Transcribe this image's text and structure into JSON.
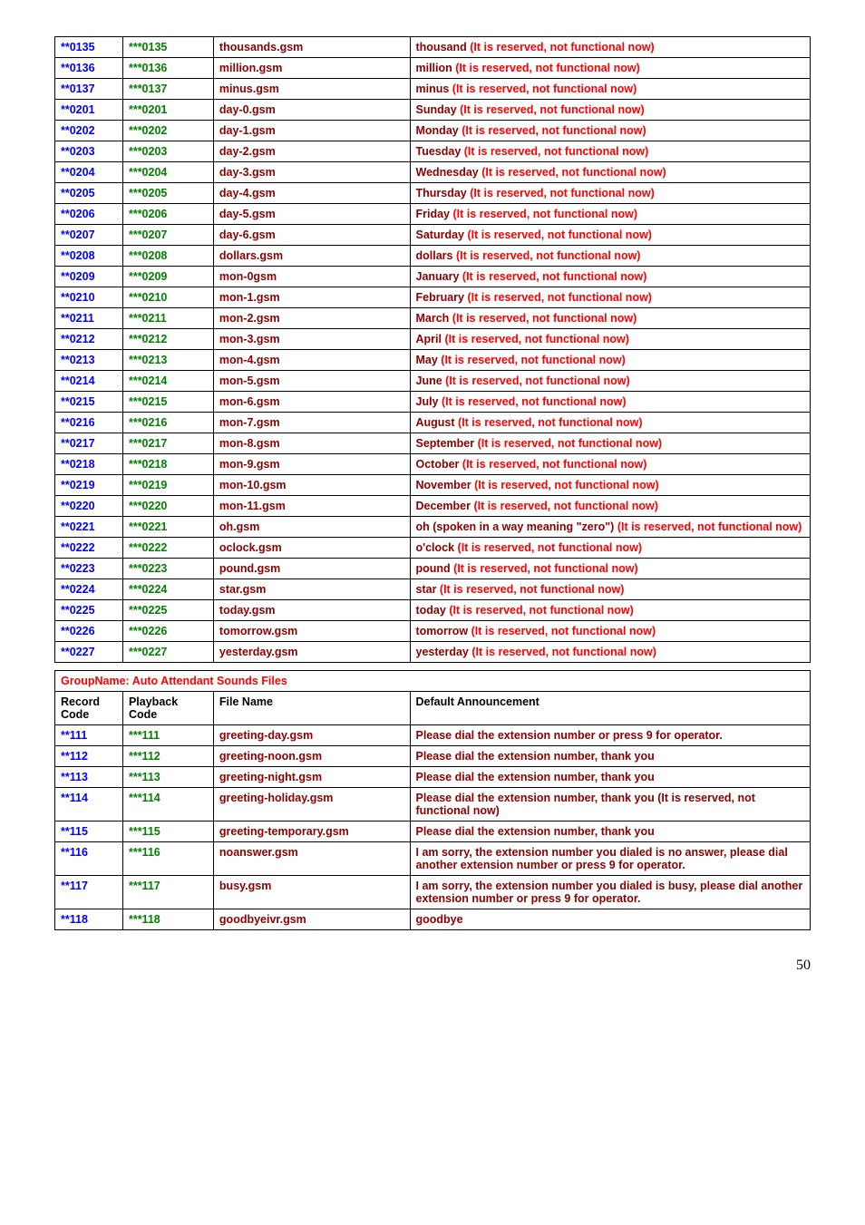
{
  "table1": [
    {
      "c1": "**0135",
      "c2": "***0135",
      "file": "thousands.gsm",
      "pre": "thousand ",
      "post": "(It is reserved, not functional now)"
    },
    {
      "c1": "**0136",
      "c2": "***0136",
      "file": "million.gsm",
      "pre": "million ",
      "post": "(It is reserved, not functional now)"
    },
    {
      "c1": "**0137",
      "c2": "***0137",
      "file": "minus.gsm",
      "pre": "minus ",
      "post": "(It is reserved, not functional now)"
    },
    {
      "c1": "**0201",
      "c2": "***0201",
      "file": "day-0.gsm",
      "pre": "Sunday ",
      "post": "(It is reserved, not functional now)"
    },
    {
      "c1": "**0202",
      "c2": "***0202",
      "file": "day-1.gsm",
      "pre": "Monday ",
      "post": "(It is reserved, not functional now)"
    },
    {
      "c1": "**0203",
      "c2": "***0203",
      "file": "day-2.gsm",
      "pre": "Tuesday ",
      "post": "(It is reserved, not functional now)"
    },
    {
      "c1": "**0204",
      "c2": "***0204",
      "file": "day-3.gsm",
      "pre": "Wednesday ",
      "post": "(It is reserved, not functional now)"
    },
    {
      "c1": "**0205",
      "c2": "***0205",
      "file": "day-4.gsm",
      "pre": "Thursday ",
      "post": "(It is reserved, not functional now)"
    },
    {
      "c1": "**0206",
      "c2": "***0206",
      "file": "day-5.gsm",
      "pre": "Friday ",
      "post": "(It is reserved, not functional now)"
    },
    {
      "c1": "**0207",
      "c2": "***0207",
      "file": "day-6.gsm",
      "pre": "Saturday ",
      "post": "(It is reserved, not functional now)"
    },
    {
      "c1": "**0208",
      "c2": "***0208",
      "file": "dollars.gsm",
      "pre": "dollars ",
      "post": "(It is reserved, not functional now)"
    },
    {
      "c1": "**0209",
      "c2": "***0209",
      "file": "mon-0gsm",
      "pre": "January ",
      "post": "(It is reserved, not functional now)"
    },
    {
      "c1": "**0210",
      "c2": "***0210",
      "file": "mon-1.gsm",
      "pre": "February ",
      "post": "(It is reserved, not functional now)"
    },
    {
      "c1": "**0211",
      "c2": "***0211",
      "file": "mon-2.gsm",
      "pre": "March ",
      "post": "(It is reserved, not functional now)"
    },
    {
      "c1": "**0212",
      "c2": "***0212",
      "file": "mon-3.gsm",
      "pre": "April ",
      "post": "(It is reserved, not functional now)"
    },
    {
      "c1": "**0213",
      "c2": "***0213",
      "file": "mon-4.gsm",
      "pre": "May ",
      "post": "(It is reserved, not functional now)"
    },
    {
      "c1": "**0214",
      "c2": "***0214",
      "file": "mon-5.gsm",
      "pre": "June ",
      "post": "(It is reserved, not functional now)"
    },
    {
      "c1": "**0215",
      "c2": "***0215",
      "file": "mon-6.gsm",
      "pre": "July ",
      "post": "(It is reserved, not functional now)"
    },
    {
      "c1": "**0216",
      "c2": "***0216",
      "file": "mon-7.gsm",
      "pre": "August ",
      "post": "(It is reserved, not functional now)"
    },
    {
      "c1": "**0217",
      "c2": "***0217",
      "file": "mon-8.gsm",
      "pre": "September ",
      "post": "(It is reserved, not functional now)"
    },
    {
      "c1": "**0218",
      "c2": "***0218",
      "file": "mon-9.gsm",
      "pre": "October ",
      "post": "(It is reserved, not functional now)"
    },
    {
      "c1": "**0219",
      "c2": "***0219",
      "file": "mon-10.gsm",
      "pre": "November ",
      "post": "(It is reserved, not functional now)"
    },
    {
      "c1": "**0220",
      "c2": "***0220",
      "file": "mon-11.gsm",
      "pre": "December ",
      "post": "(It is reserved, not functional now)"
    },
    {
      "c1": "**0221",
      "c2": "***0221",
      "file": "oh.gsm",
      "pre": "oh (spoken in a way meaning \"zero\") ",
      "post": "(It is reserved, not functional now)"
    },
    {
      "c1": "**0222",
      "c2": "***0222",
      "file": "oclock.gsm",
      "pre": "o'clock ",
      "post": "(It is reserved, not functional now)"
    },
    {
      "c1": "**0223",
      "c2": "***0223",
      "file": "pound.gsm",
      "pre": "pound ",
      "post": "(It is reserved, not functional now)"
    },
    {
      "c1": "**0224",
      "c2": "***0224",
      "file": "star.gsm",
      "pre": "star ",
      "post": "(It is reserved, not functional now)"
    },
    {
      "c1": "**0225",
      "c2": "***0225",
      "file": "today.gsm",
      "pre": "today ",
      "post": "(It is reserved, not functional now)"
    },
    {
      "c1": "**0226",
      "c2": "***0226",
      "file": "tomorrow.gsm",
      "pre": "tomorrow ",
      "post": "(It is reserved, not functional now)"
    },
    {
      "c1": "**0227",
      "c2": "***0227",
      "file": "yesterday.gsm",
      "pre": "yesterday ",
      "post": "(It is reserved, not functional now)"
    }
  ],
  "groupName": "GroupName: Auto Attendant Sounds Files",
  "header2": {
    "c1": "Record Code",
    "c2": "Playback Code",
    "c3": "File Name",
    "c4": "Default Announcement"
  },
  "table2": [
    {
      "c1": "**111",
      "c2": "***111",
      "file": "greeting-day.gsm",
      "desc": "Please dial the extension number or press 9 for operator."
    },
    {
      "c1": "**112",
      "c2": "***112",
      "file": "greeting-noon.gsm",
      "desc": "Please dial the extension number, thank you"
    },
    {
      "c1": "**113",
      "c2": "***113",
      "file": "greeting-night.gsm",
      "desc": "Please dial the extension number, thank you"
    },
    {
      "c1": "**114",
      "c2": "***114",
      "file": "greeting-holiday.gsm",
      "desc": "Please dial the extension number, thank you (It is reserved, not functional now)"
    },
    {
      "c1": "**115",
      "c2": "***115",
      "file": "greeting-temporary.gsm",
      "desc": "Please dial the extension number, thank you"
    },
    {
      "c1": "**116",
      "c2": "***116",
      "file": "noanswer.gsm",
      "desc": "I am sorry, the extension number you dialed is no answer, please dial another extension number or press 9 for operator."
    },
    {
      "c1": "**117",
      "c2": "***117",
      "file": "busy.gsm",
      "desc": "I am sorry, the extension number you dialed is busy, please dial another extension number or press 9 for operator."
    },
    {
      "c1": "**118",
      "c2": "***118",
      "file": "goodbyeivr.gsm",
      "desc": "goodbye"
    }
  ],
  "pageNum": "50"
}
